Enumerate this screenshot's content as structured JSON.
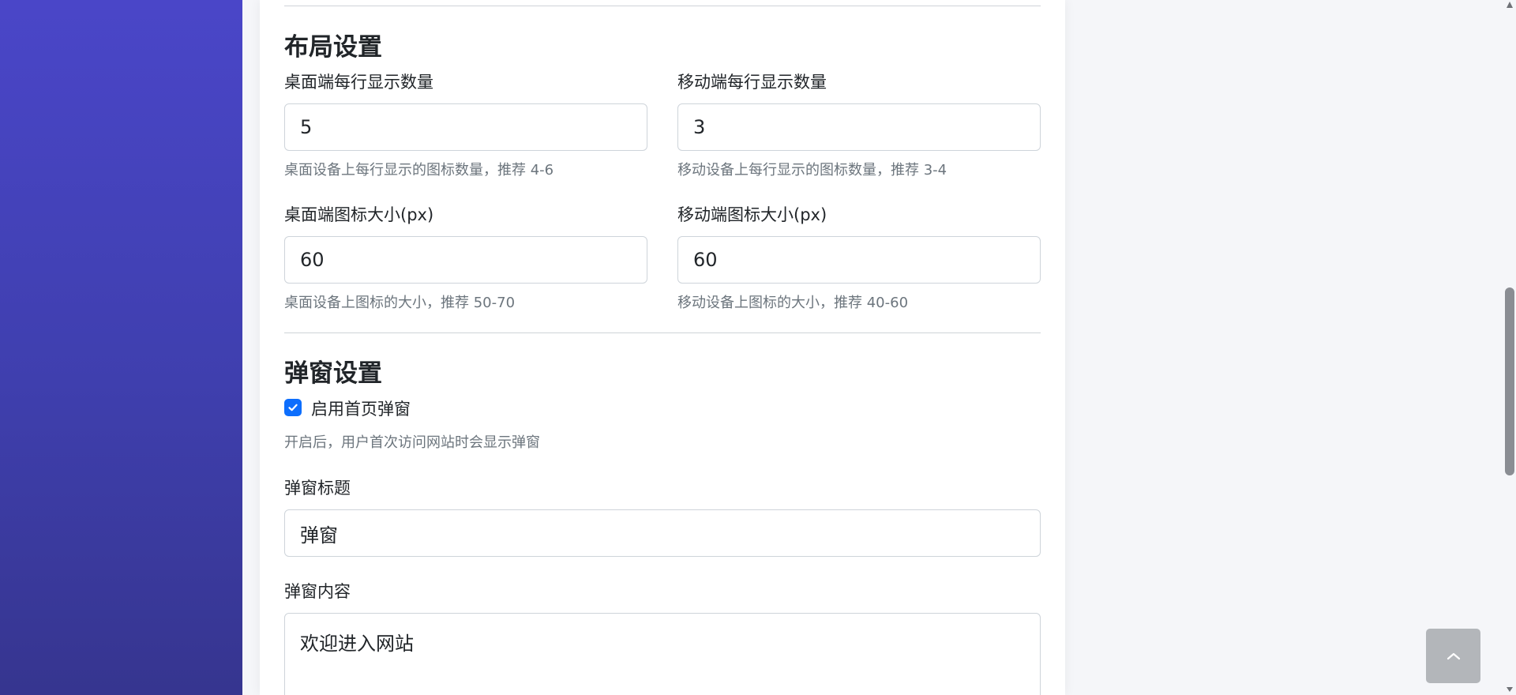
{
  "layout_section": {
    "title": "布局设置",
    "desktop_per_row": {
      "label": "桌面端每行显示数量",
      "value": "5",
      "hint": "桌面设备上每行显示的图标数量，推荐 4-6"
    },
    "mobile_per_row": {
      "label": "移动端每行显示数量",
      "value": "3",
      "hint": "移动设备上每行显示的图标数量，推荐 3-4"
    },
    "desktop_icon_size": {
      "label": "桌面端图标大小(px)",
      "value": "60",
      "hint": "桌面设备上图标的大小，推荐 50-70"
    },
    "mobile_icon_size": {
      "label": "移动端图标大小(px)",
      "value": "60",
      "hint": "移动设备上图标的大小，推荐 40-60"
    }
  },
  "popup_section": {
    "title": "弹窗设置",
    "enable": {
      "label": "启用首页弹窗",
      "checked": true,
      "hint": "开启后，用户首次访问网站时会显示弹窗"
    },
    "popup_title": {
      "label": "弹窗标题",
      "value": "弹窗"
    },
    "popup_content": {
      "label": "弹窗内容",
      "value": "欢迎进入网站"
    }
  },
  "icons": {
    "checkbox": "checkmark-icon",
    "back_to_top": "chevron-up-icon"
  },
  "colors": {
    "sidebar_gradient_top": "#4a46c8",
    "sidebar_gradient_bottom": "#36358f",
    "checkbox_accent": "#0d6efd",
    "back_to_top_bg": "#b3b6ba"
  }
}
